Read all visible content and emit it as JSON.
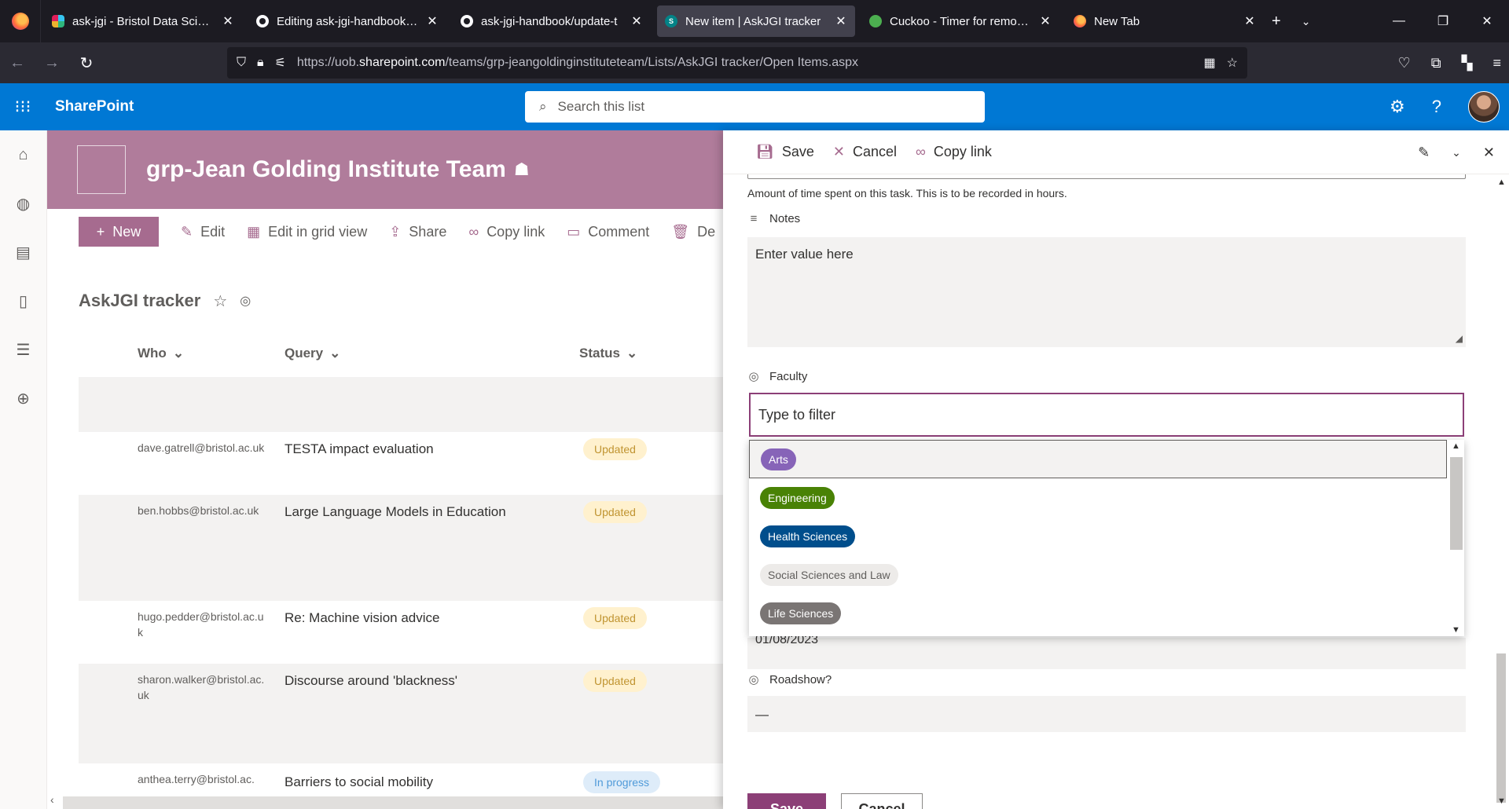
{
  "browser": {
    "tabs": [
      {
        "title": "ask-jgi - Bristol Data Science",
        "favicon": "slack-icon",
        "active": false
      },
      {
        "title": "Editing ask-jgi-handbook/upd",
        "favicon": "github-icon",
        "active": false
      },
      {
        "title": "ask-jgi-handbook/update-t",
        "favicon": "github-icon",
        "active": false
      },
      {
        "title": "New item | AskJGI tracker",
        "favicon": "sharepoint-icon",
        "active": true
      },
      {
        "title": "Cuckoo - Timer for remote t",
        "favicon": "cuckoo-icon",
        "active": false
      },
      {
        "title": "New Tab",
        "favicon": "firefox-icon",
        "active": false
      }
    ],
    "url_prefix": "https://uob.",
    "url_domain": "sharepoint.com",
    "url_path": "/teams/grp-jeangoldinginstituteteam/Lists/AskJGI tracker/Open Items.aspx"
  },
  "suite": {
    "brand": "SharePoint",
    "search_placeholder": "Search this list"
  },
  "site": {
    "title": "grp-Jean Golding Institute Team"
  },
  "commands": {
    "new": "New",
    "edit": "Edit",
    "grid": "Edit in grid view",
    "share": "Share",
    "copy_link": "Copy link",
    "comment": "Comment",
    "delete": "De"
  },
  "list": {
    "title": "AskJGI tracker",
    "columns": {
      "who": "Who",
      "query": "Query",
      "status": "Status"
    },
    "rows": [
      {
        "who": "",
        "query": "",
        "status": ""
      },
      {
        "who": "dave.gatrell@bristol.ac.uk",
        "query": "TESTA impact evaluation",
        "status": "Updated"
      },
      {
        "who": "ben.hobbs@bristol.ac.uk",
        "query": "Large Language Models in Education",
        "status": "Updated"
      },
      {
        "who": "hugo.pedder@bristol.ac.uk",
        "query": "Re: Machine vision advice",
        "status": "Updated"
      },
      {
        "who": "sharon.walker@bristol.ac.uk",
        "query": "Discourse around 'blackness'",
        "status": "Updated"
      },
      {
        "who": "anthea.terry@bristol.ac.",
        "query": "Barriers to social mobility",
        "status": "In progress"
      }
    ]
  },
  "panel": {
    "save": "Save",
    "cancel": "Cancel",
    "copy_link": "Copy link",
    "time_help": "Amount of time spent on this task. This is to be recorded in hours.",
    "notes_label": "Notes",
    "notes_placeholder": "Enter value here",
    "faculty_label": "Faculty",
    "faculty_filter_placeholder": "Type to filter",
    "faculty_options": [
      {
        "label": "Arts",
        "bg": "#8764b8",
        "fg": "#ffffff",
        "selected": true
      },
      {
        "label": "Engineering",
        "bg": "#498205",
        "fg": "#ffffff",
        "selected": false
      },
      {
        "label": "Health Sciences",
        "bg": "#004e8c",
        "fg": "#ffffff",
        "selected": false
      },
      {
        "label": "Social Sciences and Law",
        "bg": "#edebe9",
        "fg": "#605e5c",
        "selected": false
      },
      {
        "label": "Life Sciences",
        "bg": "#7a7574",
        "fg": "#ffffff",
        "selected": false
      }
    ],
    "date_value": "01/08/2023",
    "roadshow_label": "Roadshow?",
    "roadshow_value": "—",
    "save_button": "Save",
    "cancel_button": "Cancel"
  },
  "colors": {
    "suite_blue": "#0078d4",
    "site_header": "#b07c9b",
    "accent": "#8c3f77"
  }
}
